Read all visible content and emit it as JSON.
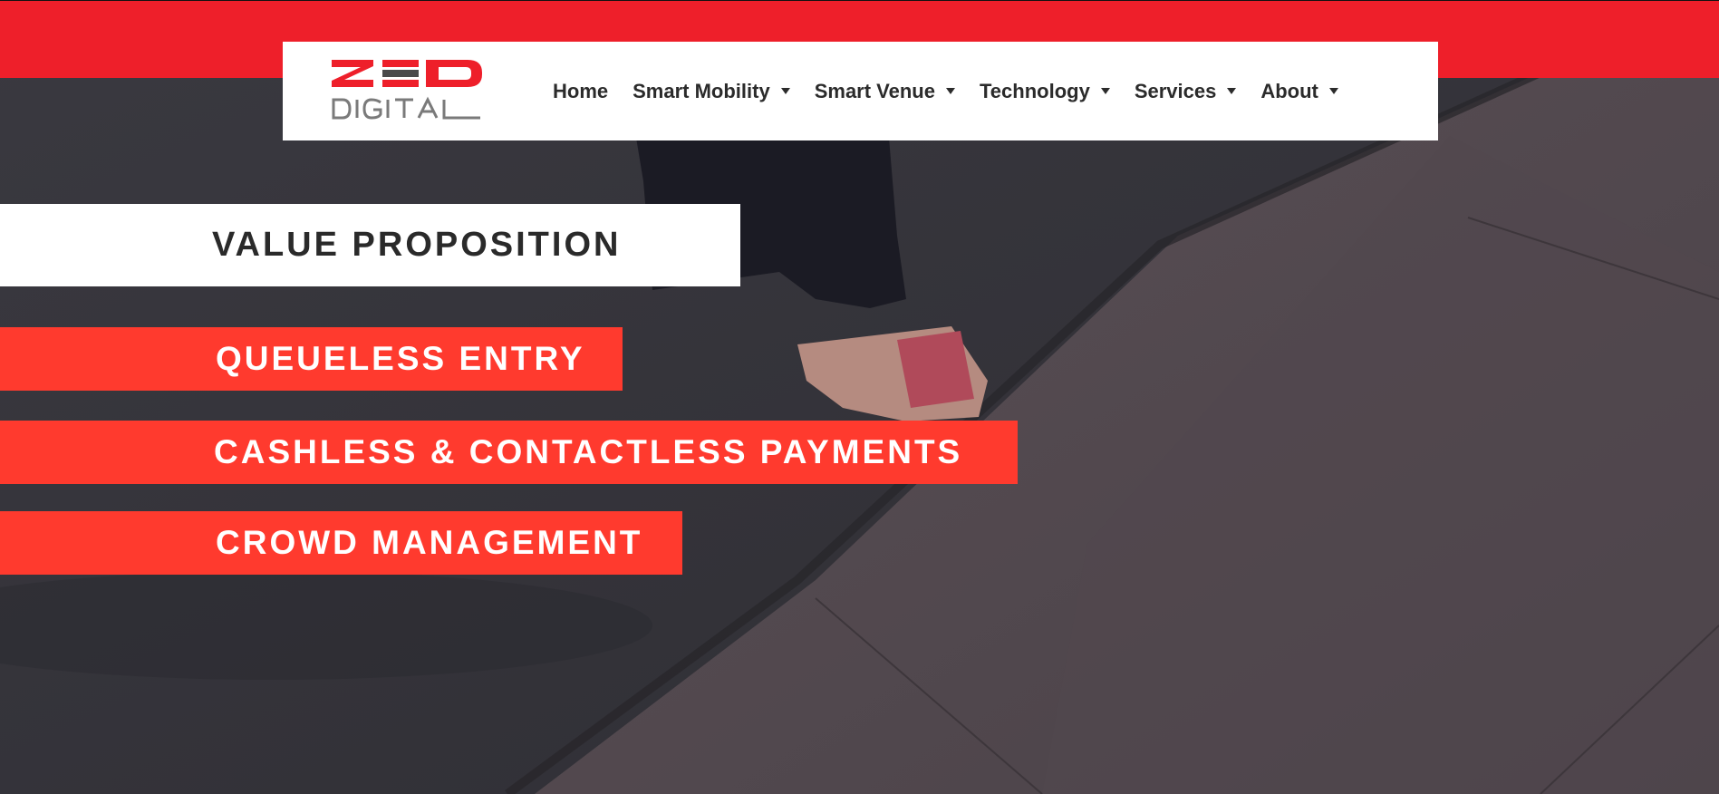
{
  "brand": {
    "logo_text_top": "ZED",
    "logo_text_bottom": "DIGITAL",
    "primary_red": "#ee1f2a",
    "banner_red": "#ff3a2e"
  },
  "nav": {
    "items": [
      {
        "label": "Home",
        "has_dropdown": false
      },
      {
        "label": "Smart Mobility",
        "has_dropdown": true
      },
      {
        "label": "Smart Venue",
        "has_dropdown": true
      },
      {
        "label": "Technology",
        "has_dropdown": true
      },
      {
        "label": "Services",
        "has_dropdown": true
      },
      {
        "label": "About",
        "has_dropdown": true
      }
    ]
  },
  "hero": {
    "heading": "VALUE PROPOSITION",
    "points": [
      "QUEUELESS ENTRY",
      "CASHLESS & CONTACTLESS PAYMENTS",
      "CROWD MANAGEMENT"
    ]
  }
}
